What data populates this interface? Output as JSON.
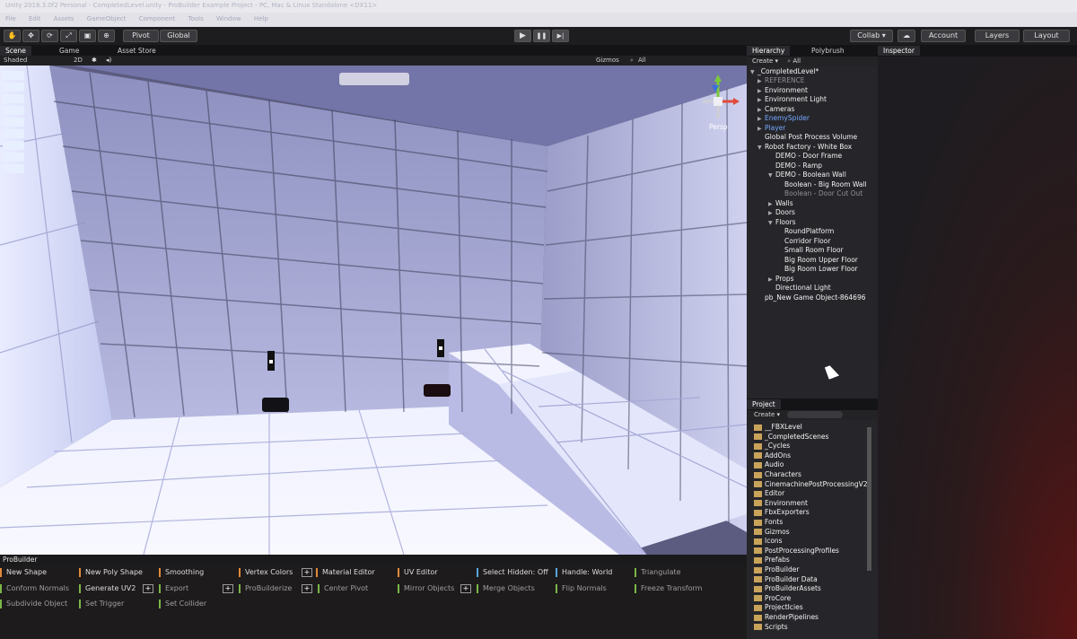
{
  "window": {
    "title": "Unity 2018.3.0f2 Personal - CompletedLevel.unity - ProBuilder Example Project - PC, Mac & Linux Standalone <DX11>",
    "menu": [
      "File",
      "Edit",
      "Assets",
      "GameObject",
      "Component",
      "Tools",
      "Window",
      "Help"
    ]
  },
  "toolbar": {
    "pivot": "Pivot",
    "global": "Global",
    "play": "▶",
    "pause": "❚❚",
    "step": "▶|",
    "collab": "Collab ▾",
    "account": "Account",
    "layers": "Layers",
    "layout": "Layout"
  },
  "scene": {
    "tabs": [
      "Scene",
      "Game",
      "Asset Store"
    ],
    "shading": "Shaded",
    "mode2d": "2D",
    "gizmos": "Gizmos",
    "search": "All",
    "persp": "Persp",
    "side_icons": [
      "",
      "",
      "",
      "",
      "",
      "",
      "",
      "",
      ""
    ]
  },
  "probuilder": {
    "header": "ProBuilder",
    "row1": [
      "New Shape",
      "New Poly Shape",
      "Smoothing",
      "Vertex Colors",
      "Material Editor",
      "UV Editor",
      "Select Hidden: Off",
      "Handle: World",
      "Triangulate"
    ],
    "row2": [
      "Conform Normals",
      "Generate UV2",
      "Export",
      "ProBuilderize",
      "Center Pivot",
      "Mirror Objects",
      "Merge Objects",
      "Flip Normals",
      "Freeze Transform"
    ],
    "row3": [
      "Subdivide Object",
      "Set Trigger",
      "Set Collider"
    ],
    "plus": "+"
  },
  "hierarchy": {
    "tabs": [
      "Hierarchy",
      "Polybrush"
    ],
    "create": "Create ▾",
    "search": "All",
    "root": "_CompletedLevel*",
    "items": [
      {
        "label": "REFERENCE",
        "style": "gray",
        "arrow": "▶"
      },
      {
        "label": "Environment",
        "style": "",
        "arrow": "▶"
      },
      {
        "label": "Environment Light",
        "style": "",
        "arrow": "▶"
      },
      {
        "label": "Cameras",
        "style": "",
        "arrow": "▶"
      },
      {
        "label": "EnemySpider",
        "style": "blue",
        "arrow": "▶"
      },
      {
        "label": "Player",
        "style": "blue",
        "arrow": "▶"
      },
      {
        "label": "Global Post Process Volume",
        "style": "",
        "arrow": ""
      },
      {
        "label": "Robot Factory - White Box",
        "style": "",
        "arrow": "▼"
      },
      {
        "label": "DEMO - Door Frame",
        "style": "",
        "arrow": ""
      },
      {
        "label": "DEMO - Ramp",
        "style": "",
        "arrow": ""
      },
      {
        "label": "DEMO - Boolean Wall",
        "style": "",
        "arrow": "▼"
      },
      {
        "label": "Boolean - Big Room Wall",
        "style": "",
        "arrow": ""
      },
      {
        "label": "Boolean - Door Cut Out",
        "style": "gray",
        "arrow": ""
      },
      {
        "label": "Walls",
        "style": "",
        "arrow": "▶"
      },
      {
        "label": "Doors",
        "style": "",
        "arrow": "▶"
      },
      {
        "label": "Floors",
        "style": "",
        "arrow": "▼"
      },
      {
        "label": "RoundPlatform",
        "style": "",
        "arrow": ""
      },
      {
        "label": "Corridor Floor",
        "style": "",
        "arrow": ""
      },
      {
        "label": "Small Room Floor",
        "style": "",
        "arrow": ""
      },
      {
        "label": "Big Room Upper Floor",
        "style": "",
        "arrow": ""
      },
      {
        "label": "Big Room Lower Floor",
        "style": "",
        "arrow": ""
      },
      {
        "label": "Props",
        "style": "",
        "arrow": "▶"
      },
      {
        "label": "Directional Light",
        "style": "",
        "arrow": ""
      },
      {
        "label": "pb_New Game Object-864696",
        "style": "",
        "arrow": ""
      }
    ]
  },
  "project": {
    "tab": "Project",
    "create": "Create ▾",
    "folders": [
      "__FBXLevel",
      "_CompletedScenes",
      "_Cycles",
      "AddOns",
      "Audio",
      "Characters",
      "CinemachinePostProcessingV2",
      "Editor",
      "Environment",
      "FbxExporters",
      "Fonts",
      "Gizmos",
      "Icons",
      "PostProcessingProfiles",
      "Prefabs",
      "ProBuilder",
      "ProBuilder Data",
      "ProBuilderAssets",
      "ProCore",
      "ProjectIcies",
      "RenderPipelines",
      "Scripts"
    ]
  },
  "inspector": {
    "tab": "Inspector"
  },
  "colors": {
    "accent_orange": "#e08a3a",
    "accent_green": "#7ab648",
    "accent_blue": "#58a6e0",
    "hierarchy_blue": "#74a8ff"
  }
}
